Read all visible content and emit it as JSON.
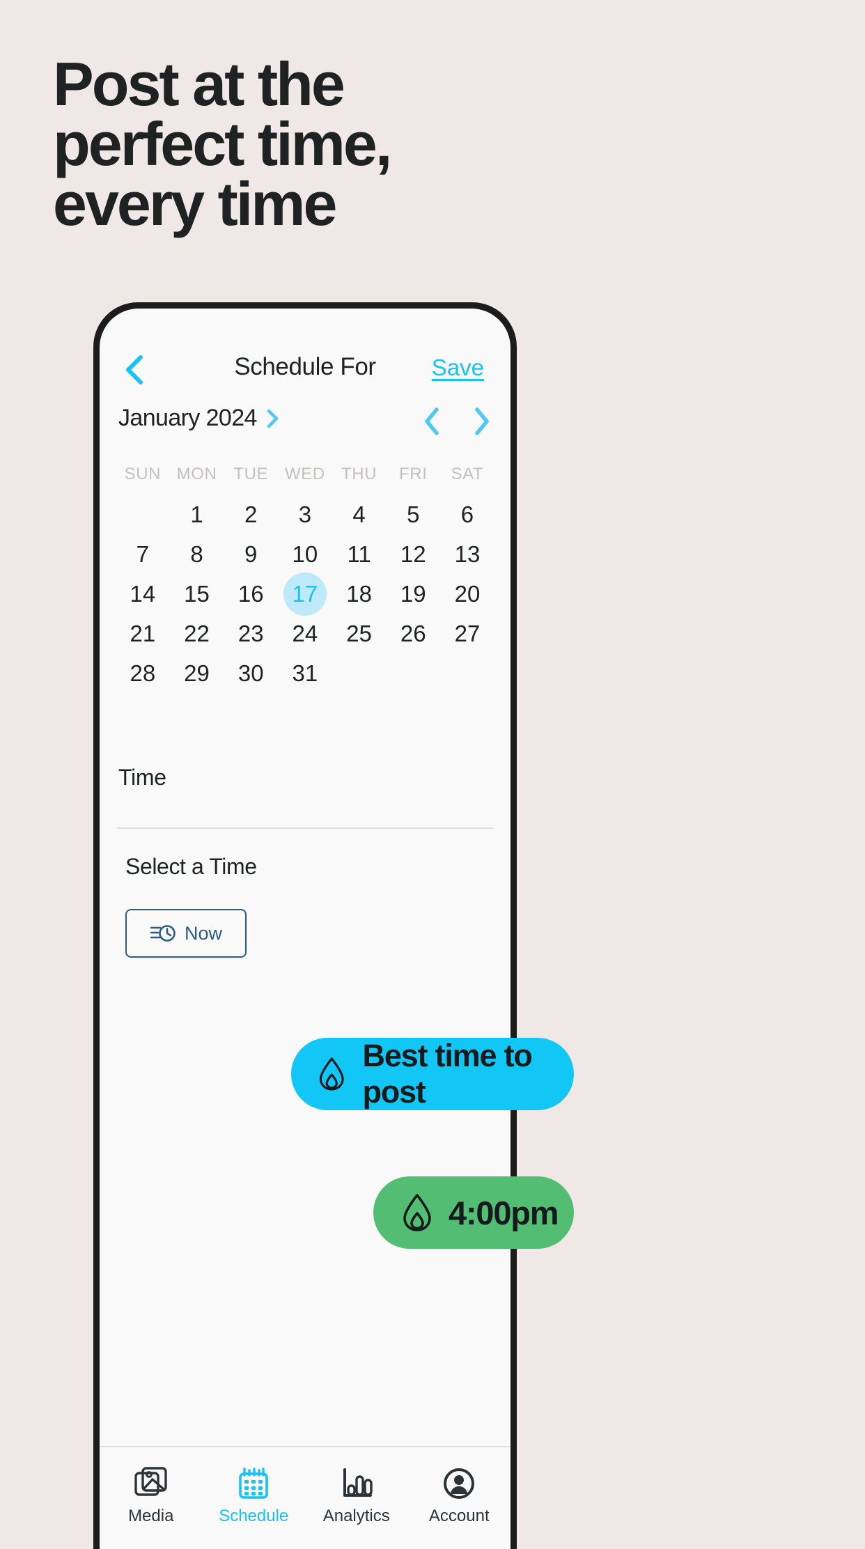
{
  "headline": {
    "lines": [
      "Post at the",
      "perfect time,",
      "every time"
    ]
  },
  "colors": {
    "page_background": "#F0E8E6",
    "accent_cyan": "#17C3F5",
    "accent_green": "#53BE73",
    "selected_day_bg": "#BEE9F9",
    "now_button_border": "#2D5B82",
    "text_dark": "#1F2222"
  },
  "app": {
    "header": {
      "back_icon": "chevron-left-icon",
      "title": "Schedule For",
      "save_label": "Save"
    },
    "month_bar": {
      "month_label": "January 2024",
      "expand_icon": "chevron-right-icon",
      "prev_icon": "chevron-left-icon",
      "next_icon": "chevron-right-icon"
    },
    "calendar": {
      "weekdays": [
        "SUN",
        "MON",
        "TUE",
        "WED",
        "THU",
        "FRI",
        "SAT"
      ],
      "weeks": [
        [
          "",
          "1",
          "2",
          "3",
          "4",
          "5",
          "6"
        ],
        [
          "7",
          "8",
          "9",
          "10",
          "11",
          "12",
          "13"
        ],
        [
          "14",
          "15",
          "16",
          "17",
          "18",
          "19",
          "20"
        ],
        [
          "21",
          "22",
          "23",
          "24",
          "25",
          "26",
          "27"
        ],
        [
          "28",
          "29",
          "30",
          "31",
          "",
          "",
          ""
        ]
      ],
      "selected_day": "17"
    },
    "time_section": {
      "time_label": "Time",
      "select_time_label": "Select a Time",
      "now_button": {
        "label": "Now",
        "icon": "list-clock-icon"
      }
    },
    "tabbar": {
      "items": [
        {
          "label": "Media",
          "icon": "media-images-icon",
          "active": false
        },
        {
          "label": "Schedule",
          "icon": "calendar-icon",
          "active": true
        },
        {
          "label": "Analytics",
          "icon": "bar-chart-icon",
          "active": false
        },
        {
          "label": "Account",
          "icon": "user-circle-icon",
          "active": false
        }
      ]
    }
  },
  "callouts": {
    "best_time": {
      "label": "Best time to post",
      "icon": "flame-icon",
      "color": "#12C6F5"
    },
    "suggested_time": {
      "label": "4:00pm",
      "icon": "flame-icon",
      "color": "#53BE73"
    }
  }
}
